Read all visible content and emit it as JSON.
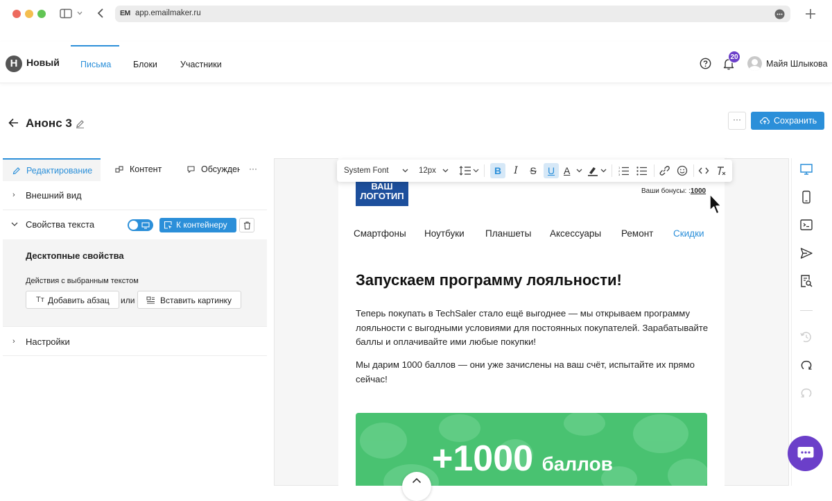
{
  "browser": {
    "favicon_text": "EM",
    "url": "app.emailmaker.ru"
  },
  "header": {
    "logo_letter": "H",
    "project_name": "Новый",
    "tabs": [
      {
        "label": "Письма",
        "active": true
      },
      {
        "label": "Блоки",
        "active": false
      },
      {
        "label": "Участники",
        "active": false
      }
    ],
    "notifications_count": "20",
    "user_name": "Майя Шлыкова"
  },
  "title_row": {
    "title": "Анонс 3",
    "more_label": "···",
    "save_label": "Сохранить"
  },
  "left_panel": {
    "tabs": [
      {
        "label": "Редактирование",
        "active": true
      },
      {
        "label": "Контент",
        "active": false
      },
      {
        "label": "Обсужден",
        "active": false
      }
    ],
    "tabs_more": "···",
    "sections": {
      "appearance": "Внешний вид",
      "text_props": "Свойства текста",
      "to_container": "К контейнеру",
      "desktop_props": "Десктопные свойства",
      "actions_caption": "Действия с выбранным текстом",
      "add_paragraph": "Добавить абзац",
      "or": "или",
      "insert_image": "Вставить картинку",
      "settings": "Настройки"
    }
  },
  "toolbar": {
    "font": "System Font",
    "size": "12px"
  },
  "email": {
    "logo_line1": "ВАШ",
    "logo_line2": "ЛОГОТИП",
    "bonus_label": "Ваши бонусы: :",
    "bonus_value": "1000",
    "menu": [
      "Смартфоны",
      "Ноутбуки",
      "Планшеты",
      "Аксессуары",
      "Ремонт",
      "Скидки"
    ],
    "headline": "Запускаем программу лояльности!",
    "para1": "Теперь покупать в TechSaler стало ещё выгоднее — мы открываем программу лояльности с выгодными условиями для постоянных покупателей. Зарабатывайте баллы и оплачивайте ими любые покупки!",
    "para2": "Мы дарим 1000 баллов — они уже зачислены на ваш счёт, испытайте их прямо сейчас!",
    "banner_number": "+1000",
    "banner_word": "баллов"
  },
  "colors": {
    "accent": "#2b8fd9",
    "banner_green": "#49c271",
    "logo_blue": "#1d4f9c",
    "badge_purple": "#6b3fc9"
  }
}
